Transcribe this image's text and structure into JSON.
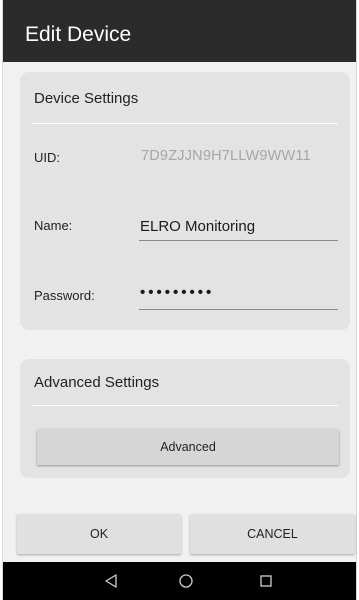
{
  "titlebar": {
    "title": "Edit Device"
  },
  "device_settings": {
    "title": "Device Settings",
    "uid": {
      "label": "UID:",
      "value": "7D9ZJJN9H7LLW9WW11"
    },
    "name": {
      "label": "Name:",
      "value": "ELRO Monitoring"
    },
    "password": {
      "label": "Password:",
      "value": "•••••••••"
    }
  },
  "advanced_settings": {
    "title": "Advanced Settings",
    "button_label": "Advanced"
  },
  "dialog": {
    "ok_label": "OK",
    "cancel_label": "CANCEL"
  },
  "navbar": {
    "icons": [
      "back-icon",
      "home-icon",
      "recents-icon"
    ]
  },
  "colors": {
    "titlebar_bg": "#2b2b2b",
    "card_bg": "#e3e3e3",
    "readonly_text": "#a6a6a6",
    "navbar_bg": "#000000"
  }
}
